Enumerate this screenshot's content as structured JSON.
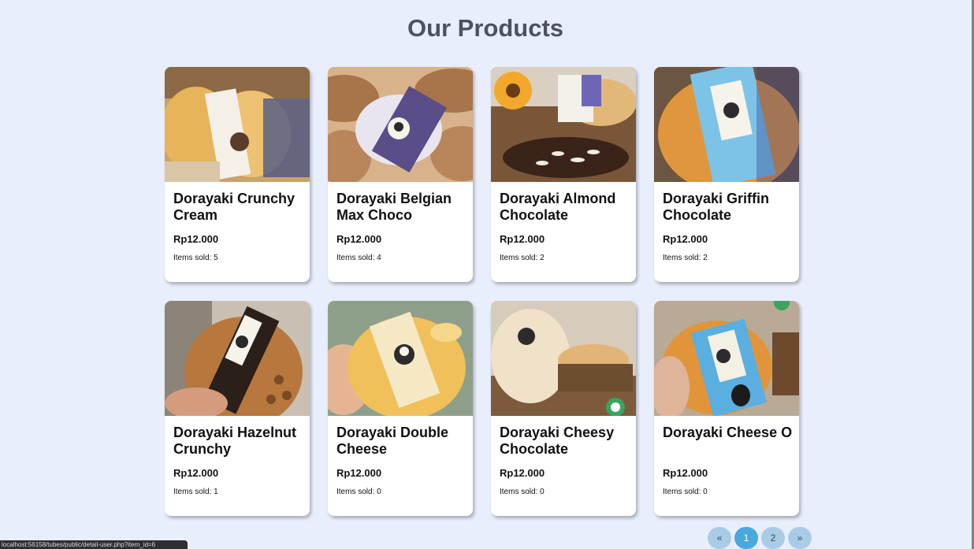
{
  "page": {
    "title": "Our Products"
  },
  "products": [
    {
      "name": "Dorayaki Crunchy Cream",
      "price": "Rp12.000",
      "sold": "Items sold: 5"
    },
    {
      "name": "Dorayaki Belgian Max Choco",
      "price": "Rp12.000",
      "sold": "Items sold: 4"
    },
    {
      "name": "Dorayaki Almond Chocolate",
      "price": "Rp12.000",
      "sold": "Items sold: 2"
    },
    {
      "name": "Dorayaki Griffin Chocolate",
      "price": "Rp12.000",
      "sold": "Items sold: 2"
    },
    {
      "name": "Dorayaki Hazelnut Crunchy",
      "price": "Rp12.000",
      "sold": "Items sold: 1"
    },
    {
      "name": "Dorayaki Double Cheese",
      "price": "Rp12.000",
      "sold": "Items sold: 0"
    },
    {
      "name": "Dorayaki Cheesy Chocolate",
      "price": "Rp12.000",
      "sold": "Items sold: 0"
    },
    {
      "name": "Dorayaki Cheese O",
      "price": "Rp12.000",
      "sold": "Items sold: 0"
    }
  ],
  "pagination": {
    "prev": "«",
    "pages": [
      "1",
      "2"
    ],
    "next": "»",
    "current": "1"
  },
  "status_bar": {
    "url": "localhost:56158/tubes/public/detail-user.php?item_id=6"
  },
  "colors": {
    "background": "#e9eefc",
    "title": "#4b5261",
    "page_active": "#4aa8df",
    "page_inactive": "#a9cce6"
  }
}
